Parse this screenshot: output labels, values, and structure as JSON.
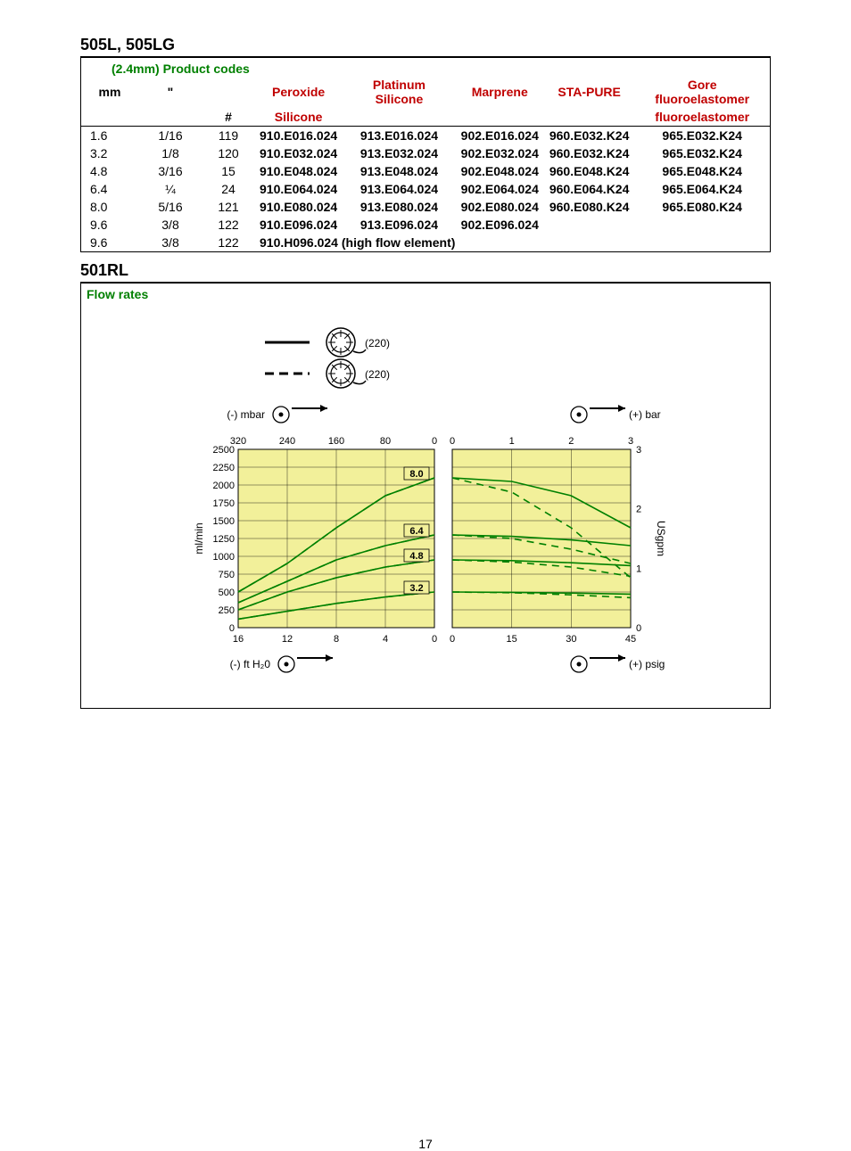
{
  "page_number": "17",
  "section1": {
    "title": "505L, 505LG",
    "table_caption": "(2.4mm)  Product codes",
    "headers": {
      "mm": "mm",
      "inch": "\"",
      "hash": "#",
      "peroxide": "Peroxide Silicone",
      "platinum": "Platinum Silicone",
      "marprene": "Marprene",
      "stapure": "STA-PURE",
      "gore": "Gore fluoroelastomer"
    },
    "rows": [
      {
        "mm": "1.6",
        "inch": "1/16",
        "hash": "119",
        "peroxide": "910.E016.024",
        "platinum": "913.E016.024",
        "marprene": "902.E016.024",
        "stapure": "960.E032.K24",
        "gore": "965.E032.K24"
      },
      {
        "mm": "3.2",
        "inch": "1/8",
        "hash": "120",
        "peroxide": "910.E032.024",
        "platinum": "913.E032.024",
        "marprene": "902.E032.024",
        "stapure": "960.E032.K24",
        "gore": "965.E032.K24"
      },
      {
        "mm": "4.8",
        "inch": "3/16",
        "hash": "15",
        "peroxide": "910.E048.024",
        "platinum": "913.E048.024",
        "marprene": "902.E048.024",
        "stapure": "960.E048.K24",
        "gore": "965.E048.K24"
      },
      {
        "mm": "6.4",
        "inch": "¼",
        "hash": "24",
        "peroxide": "910.E064.024",
        "platinum": "913.E064.024",
        "marprene": "902.E064.024",
        "stapure": "960.E064.K24",
        "gore": "965.E064.K24"
      },
      {
        "mm": "8.0",
        "inch": "5/16",
        "hash": "121",
        "peroxide": "910.E080.024",
        "platinum": "913.E080.024",
        "marprene": "902.E080.024",
        "stapure": "960.E080.K24",
        "gore": "965.E080.K24"
      },
      {
        "mm": "9.6",
        "inch": "3/8",
        "hash": "122",
        "peroxide": "910.E096.024",
        "platinum": "913.E096.024",
        "marprene": "902.E096.024",
        "stapure": "",
        "gore": ""
      },
      {
        "mm": "9.6",
        "inch": "3/8",
        "hash": "122",
        "peroxide": "910.H096.024 (high flow element)",
        "platinum": "",
        "marprene": "",
        "stapure": "",
        "gore": ""
      }
    ]
  },
  "section2": {
    "title": "501RL",
    "flow_title": "Flow rates",
    "legend": {
      "solid": "(220)",
      "dashed": "(220)"
    },
    "axis_labels": {
      "left_top": "(-) mbar",
      "right_top": "(+) bar",
      "left_bottom": "(-) ft H₂0",
      "right_bottom": "(+) psig",
      "y_left": "ml/min",
      "y_right": "USgpm"
    },
    "curve_labels": [
      "8.0",
      "6.4",
      "4.8",
      "3.2"
    ]
  },
  "chart_data": {
    "type": "line",
    "title": "Flow rates",
    "y_left_label": "ml/min",
    "y_right_label": "USgpm",
    "y_left_ticks": [
      0,
      250,
      500,
      750,
      1000,
      1250,
      1500,
      1750,
      2000,
      2250,
      2500
    ],
    "y_right_ticks": [
      0,
      1,
      2,
      3
    ],
    "left_panel": {
      "x_top_label": "(-) mbar",
      "x_bottom_label": "(-) ft H₂0",
      "x_top_ticks": [
        320,
        240,
        160,
        80,
        0
      ],
      "x_bottom_ticks": [
        16,
        12,
        8,
        4,
        0
      ]
    },
    "right_panel": {
      "x_top_label": "(+) bar",
      "x_bottom_label": "(+) psig",
      "x_top_ticks": [
        0,
        1,
        2,
        3
      ],
      "x_bottom_ticks": [
        0,
        15,
        30,
        45
      ]
    },
    "series": [
      {
        "name": "8.0",
        "style": "solid",
        "left": {
          "x_mbar": [
            320,
            240,
            160,
            80,
            0
          ],
          "y_mlmin": [
            500,
            900,
            1400,
            1850,
            2100
          ]
        },
        "right": {
          "x_bar": [
            0,
            1,
            2,
            3
          ],
          "y_mlmin": [
            2100,
            2050,
            1850,
            1400
          ]
        }
      },
      {
        "name": "6.4",
        "style": "solid",
        "left": {
          "x_mbar": [
            320,
            240,
            160,
            80,
            0
          ],
          "y_mlmin": [
            350,
            650,
            950,
            1150,
            1300
          ]
        },
        "right": {
          "x_bar": [
            0,
            1,
            2,
            3
          ],
          "y_mlmin": [
            1300,
            1280,
            1230,
            1150
          ]
        }
      },
      {
        "name": "4.8",
        "style": "solid",
        "left": {
          "x_mbar": [
            320,
            240,
            160,
            80,
            0
          ],
          "y_mlmin": [
            250,
            500,
            700,
            850,
            950
          ]
        },
        "right": {
          "x_bar": [
            0,
            1,
            2,
            3
          ],
          "y_mlmin": [
            950,
            940,
            910,
            870
          ]
        }
      },
      {
        "name": "3.2",
        "style": "solid",
        "left": {
          "x_mbar": [
            320,
            240,
            160,
            80,
            0
          ],
          "y_mlmin": [
            120,
            230,
            340,
            430,
            500
          ]
        },
        "right": {
          "x_bar": [
            0,
            1,
            2,
            3
          ],
          "y_mlmin": [
            500,
            495,
            485,
            470
          ]
        }
      },
      {
        "name": "8.0",
        "style": "dashed",
        "left": {
          "x_mbar": [
            320,
            240,
            160,
            80,
            0
          ],
          "y_mlmin": [
            500,
            900,
            1400,
            1850,
            2100
          ]
        },
        "right": {
          "x_bar": [
            0,
            1,
            2,
            3
          ],
          "y_mlmin": [
            2100,
            1900,
            1400,
            700
          ]
        }
      },
      {
        "name": "6.4",
        "style": "dashed",
        "left": {
          "x_mbar": [
            320,
            240,
            160,
            80,
            0
          ],
          "y_mlmin": [
            350,
            650,
            950,
            1150,
            1300
          ]
        },
        "right": {
          "x_bar": [
            0,
            1,
            2,
            3
          ],
          "y_mlmin": [
            1300,
            1250,
            1100,
            900
          ]
        }
      },
      {
        "name": "4.8",
        "style": "dashed",
        "left": {
          "x_mbar": [
            320,
            240,
            160,
            80,
            0
          ],
          "y_mlmin": [
            250,
            500,
            700,
            850,
            950
          ]
        },
        "right": {
          "x_bar": [
            0,
            1,
            2,
            3
          ],
          "y_mlmin": [
            950,
            920,
            850,
            720
          ]
        }
      },
      {
        "name": "3.2",
        "style": "dashed",
        "left": {
          "x_mbar": [
            320,
            240,
            160,
            80,
            0
          ],
          "y_mlmin": [
            120,
            230,
            340,
            430,
            500
          ]
        },
        "right": {
          "x_bar": [
            0,
            1,
            2,
            3
          ],
          "y_mlmin": [
            500,
            490,
            460,
            420
          ]
        }
      }
    ]
  }
}
